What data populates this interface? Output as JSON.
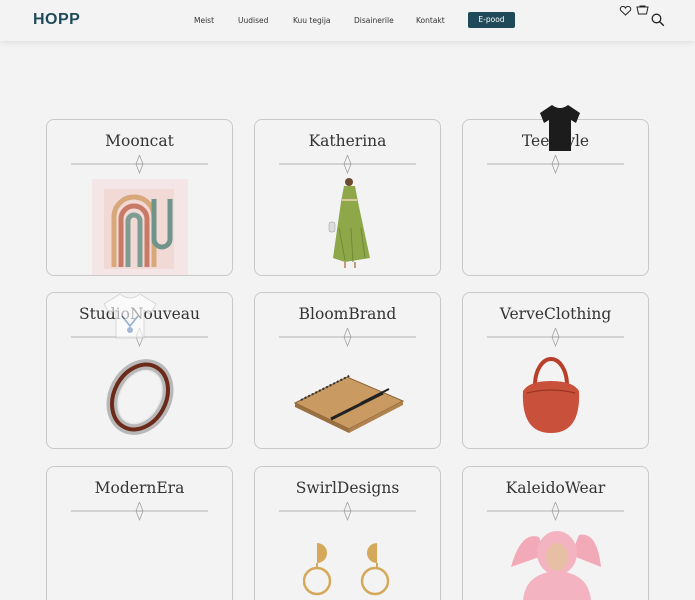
{
  "header": {
    "logo": "HOPP",
    "nav": [
      {
        "label": "Meist"
      },
      {
        "label": "Uudised"
      },
      {
        "label": "Kuu tegija"
      },
      {
        "label": "Disainerile"
      },
      {
        "label": "Kontakt"
      }
    ],
    "shop_button": "E-pood",
    "icons": [
      "heart-icon",
      "cart-icon",
      "search-icon"
    ]
  },
  "brands": [
    {
      "name": "Mooncat",
      "image": "rainbow-art-print"
    },
    {
      "name": "Katherina",
      "image": "green-dress"
    },
    {
      "name": "TeeStyle",
      "image": "black-tshirt"
    },
    {
      "name": "StudioNouveau",
      "image": "wooden-inlay-ring"
    },
    {
      "name": "BloomBrand",
      "image": "bamboo-notebook"
    },
    {
      "name": "VerveClothing",
      "image": "red-handbag"
    },
    {
      "name": "ModernEra",
      "image": ""
    },
    {
      "name": "SwirlDesigns",
      "image": "gold-earrings"
    },
    {
      "name": "KaleidoWear",
      "image": "pink-hoodie-model"
    }
  ],
  "colors": {
    "brand": "#1f4a5a",
    "background": "#f3f3f4",
    "border": "#c9c9c9"
  }
}
